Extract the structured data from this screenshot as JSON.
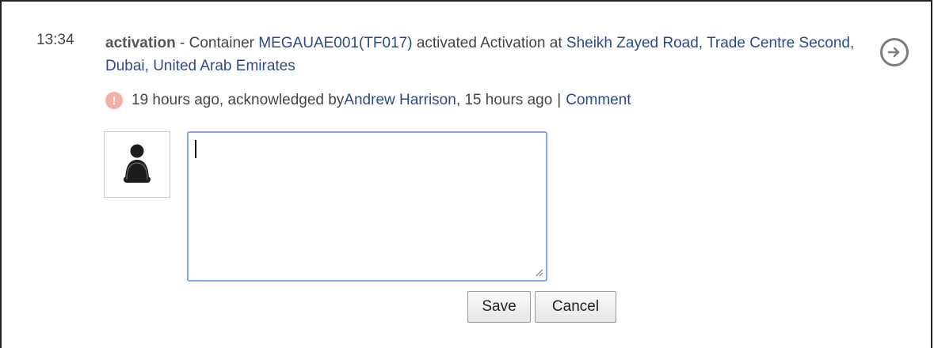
{
  "event": {
    "time": "13:34",
    "type": "activation",
    "separator": " - ",
    "description_prefix": "Container ",
    "container_id": "MEGAUAE001(TF017)",
    "description_middle": " activated Activation at ",
    "location": "Sheikh Zayed Road, Trade Centre Second, Dubai, United Arab Emirates"
  },
  "meta": {
    "age": "19 hours ago, acknowledged by ",
    "user": "Andrew Harrison",
    "ack_age": ", 15 hours ago",
    "divider": "|",
    "comment_link": "Comment"
  },
  "comment": {
    "value": "",
    "save_label": "Save",
    "cancel_label": "Cancel"
  },
  "colors": {
    "link": "#2c4a8a",
    "alert": "#f4b0a6",
    "focus_border": "#7ea8e8"
  },
  "icons": {
    "go": "arrow-right-circle-icon",
    "alert": "alert-circle-icon",
    "avatar": "user-avatar-icon"
  }
}
